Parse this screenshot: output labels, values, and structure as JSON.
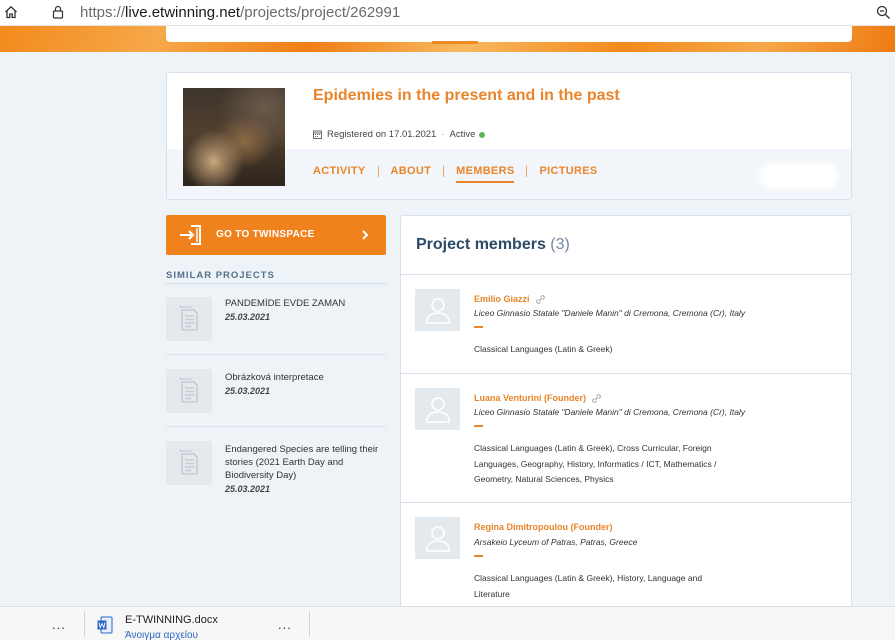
{
  "browser": {
    "url_prefix": "https://",
    "url_host": "live.etwinning.net",
    "url_path": "/projects/project/262991"
  },
  "project": {
    "title": "Epidemies in the present and in the past",
    "registered": "Registered on 17.01.2021",
    "status": "Active",
    "status_color": "#5cb85c",
    "tabs": [
      {
        "label": "ACTIVITY",
        "active": false
      },
      {
        "label": "ABOUT",
        "active": false
      },
      {
        "label": "MEMBERS",
        "active": true
      },
      {
        "label": "PICTURES",
        "active": false
      }
    ]
  },
  "sidebar": {
    "twinspace_label": "GO TO TWINSPACE",
    "similar_heading": "SIMILAR PROJECTS",
    "similar": [
      {
        "title": "PANDEMİDE EVDE ZAMAN",
        "date": "25.03.2021"
      },
      {
        "title": "Obrázková interpretace",
        "date": "25.03.2021"
      },
      {
        "title": "Endangered Species are telling their stories (2021 Earth Day and Biodiversity Day)",
        "date": "25.03.2021"
      }
    ]
  },
  "members": {
    "title": "Project members",
    "count": "(3)",
    "list": [
      {
        "name": "Emilio Giazzi",
        "school": "Liceo Ginnasio Statale \"Daniele Manin\" di Cremona, Cremona (Cr), Italy",
        "subjects": "Classical Languages (Latin & Greek)"
      },
      {
        "name": "Luana Venturini (Founder)",
        "school": "Liceo Ginnasio Statale \"Daniele Manin\" di Cremona, Cremona (Cr), Italy",
        "subjects": "Classical Languages (Latin & Greek), Cross Curricular, Foreign Languages, Geography, History, Informatics / ICT, Mathematics / Geometry, Natural Sciences, Physics"
      },
      {
        "name": "Regina Dimitropoulou (Founder)",
        "school": "Arsakeio Lyceum of Patras, Patras, Greece",
        "subjects": "Classical Languages (Latin & Greek), History, Language and Literature"
      }
    ]
  },
  "download": {
    "file_name": "E-TWINNING.docx",
    "action": "Άνοιγμα αρχείου",
    "more": "..."
  },
  "colors": {
    "accent": "#e9852a",
    "button": "#f0821e",
    "heading": "#2d4a66"
  }
}
